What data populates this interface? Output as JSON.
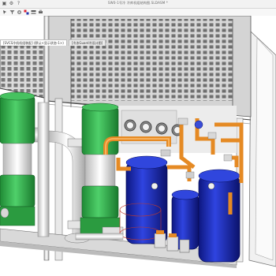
{
  "window": {
    "title": "SW0-1号冷 冷库机组结构图.SLDASM *"
  },
  "tabs": [
    {
      "label": "[SVCS冷机机组装配] (默认<显示状态-1>)"
    },
    {
      "label": "[冷冻Guard冷设计图]"
    }
  ],
  "toolbar_icons": [
    "select-icon",
    "filter-icon",
    "gear-icon",
    "color-icon",
    "layers-icon",
    "print-icon"
  ],
  "colors": {
    "pump_green": "#2fae4a",
    "pipe_orange": "#e58a24",
    "tank_blue": "#1f2fb8",
    "frame_grey": "#d9d9d9"
  }
}
